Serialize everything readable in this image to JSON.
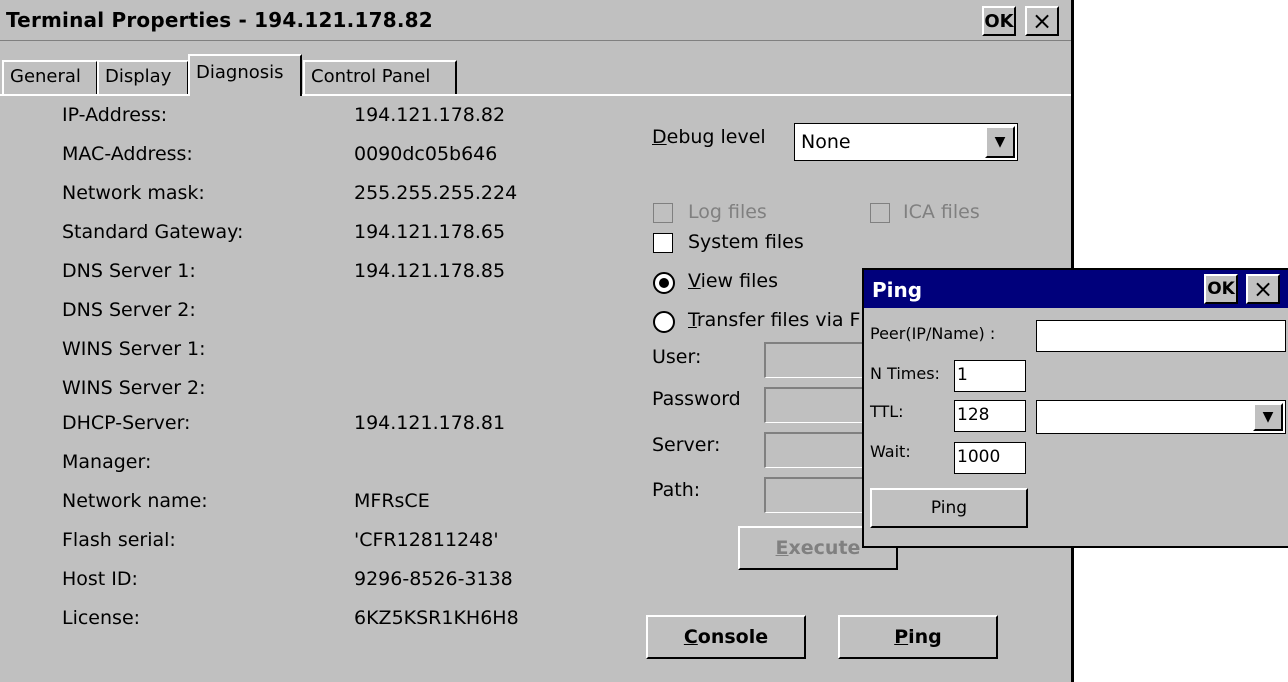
{
  "window": {
    "title": "Terminal Properties - 194.121.178.82",
    "ok_label": "OK",
    "close_label": "×"
  },
  "tabs": [
    {
      "label": "General"
    },
    {
      "label": "Display"
    },
    {
      "label": "Diagnosis"
    },
    {
      "label": "Control Panel"
    }
  ],
  "info": [
    {
      "label": "IP-Address:",
      "value": "194.121.178.82"
    },
    {
      "label": "MAC-Address:",
      "value": "0090dc05b646"
    },
    {
      "label": "Network mask:",
      "value": "255.255.255.224"
    },
    {
      "label": "Standard Gateway:",
      "value": "194.121.178.65"
    },
    {
      "label": "DNS Server 1:",
      "value": "194.121.178.85"
    },
    {
      "label": "DNS Server 2:",
      "value": ""
    },
    {
      "label": "WINS Server 1:",
      "value": ""
    },
    {
      "label": "WINS Server 2:",
      "value": ""
    },
    {
      "label": "DHCP-Server:",
      "value": "194.121.178.81"
    },
    {
      "label": "Manager:",
      "value": ""
    },
    {
      "label": "Network name:",
      "value": "MFRsCE"
    },
    {
      "label": "Flash serial:",
      "value": "'CFR12811248'"
    },
    {
      "label": "Host ID:",
      "value": "9296-8526-3138"
    },
    {
      "label": "License:",
      "value": "6KZ5KSR1KH6H8"
    }
  ],
  "debug": {
    "label_first": "D",
    "label_rest": "ebug level",
    "value": "None"
  },
  "options": {
    "log_files": "Log files",
    "ica_files": "ICA files",
    "system_files": "System files",
    "view_files_first": "V",
    "view_files_rest": "iew files",
    "transfer_first": "T",
    "transfer_rest": "ransfer files via F"
  },
  "transfer": {
    "user_label": "User:",
    "password_label": "Password",
    "server_label": "Server:",
    "path_label": "Path:",
    "execute_first": "E",
    "execute_rest": "xecute"
  },
  "buttons": {
    "console_first": "C",
    "console_rest": "onsole",
    "ping_first": "P",
    "ping_rest": "ing"
  },
  "ping_dialog": {
    "title": "Ping",
    "ok_label": "OK",
    "close_label": "×",
    "peer_label": "Peer(IP/Name) :",
    "peer_value": "",
    "ntimes_label": "N Times:",
    "ntimes_value": "1",
    "ttl_label": "TTL:",
    "ttl_value": "128",
    "ttl_combo_value": "",
    "wait_label": "Wait:",
    "wait_value": "1000",
    "ping_button": "Ping"
  }
}
